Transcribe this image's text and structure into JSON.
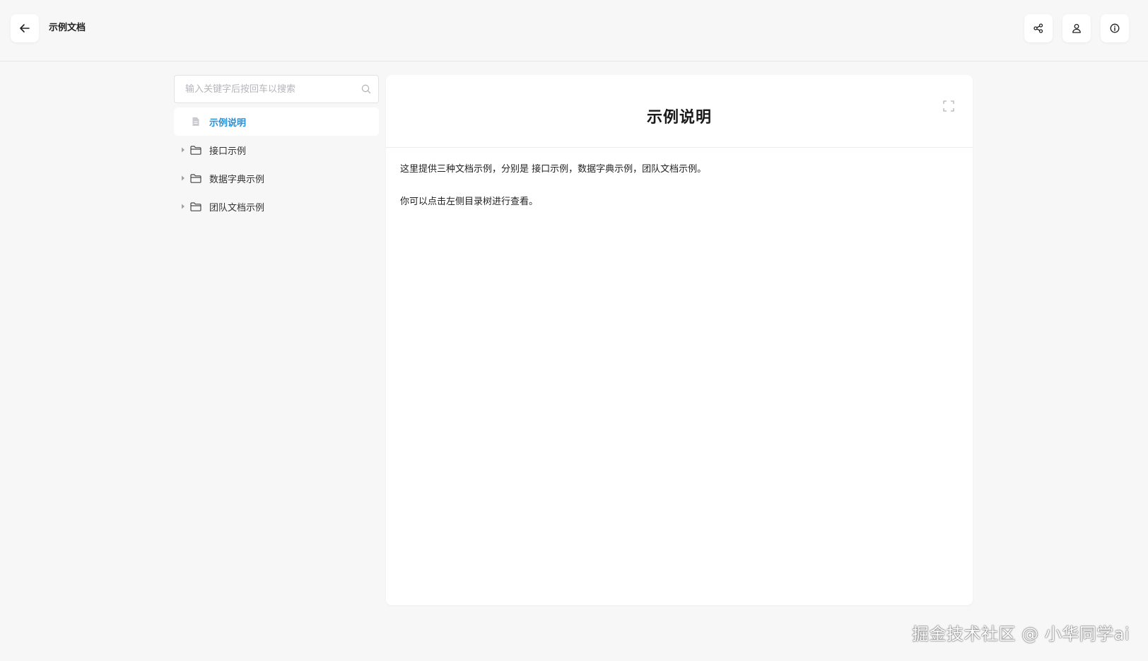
{
  "header": {
    "doc_title": "示例文档",
    "back_icon": "arrow-left-icon",
    "share_icon": "share-icon",
    "user_icon": "user-icon",
    "info_icon": "info-icon"
  },
  "sidebar": {
    "search_placeholder": "输入关键字后按回车以搜索",
    "items": [
      {
        "label": "示例说明",
        "type": "file",
        "active": true
      },
      {
        "label": "接口示例",
        "type": "folder",
        "active": false
      },
      {
        "label": "数据字典示例",
        "type": "folder",
        "active": false
      },
      {
        "label": "团队文档示例",
        "type": "folder",
        "active": false
      }
    ]
  },
  "content": {
    "title": "示例说明",
    "paragraphs": [
      "这里提供三种文档示例，分别是 接口示例，数据字典示例，团队文档示例。",
      "你可以点击左侧目录树进行查看。"
    ]
  },
  "watermark": "掘金技术社区 @ 小华同学ai",
  "colors": {
    "accent": "#2a8fd6",
    "background": "#f7f7f8",
    "card": "#ffffff"
  }
}
